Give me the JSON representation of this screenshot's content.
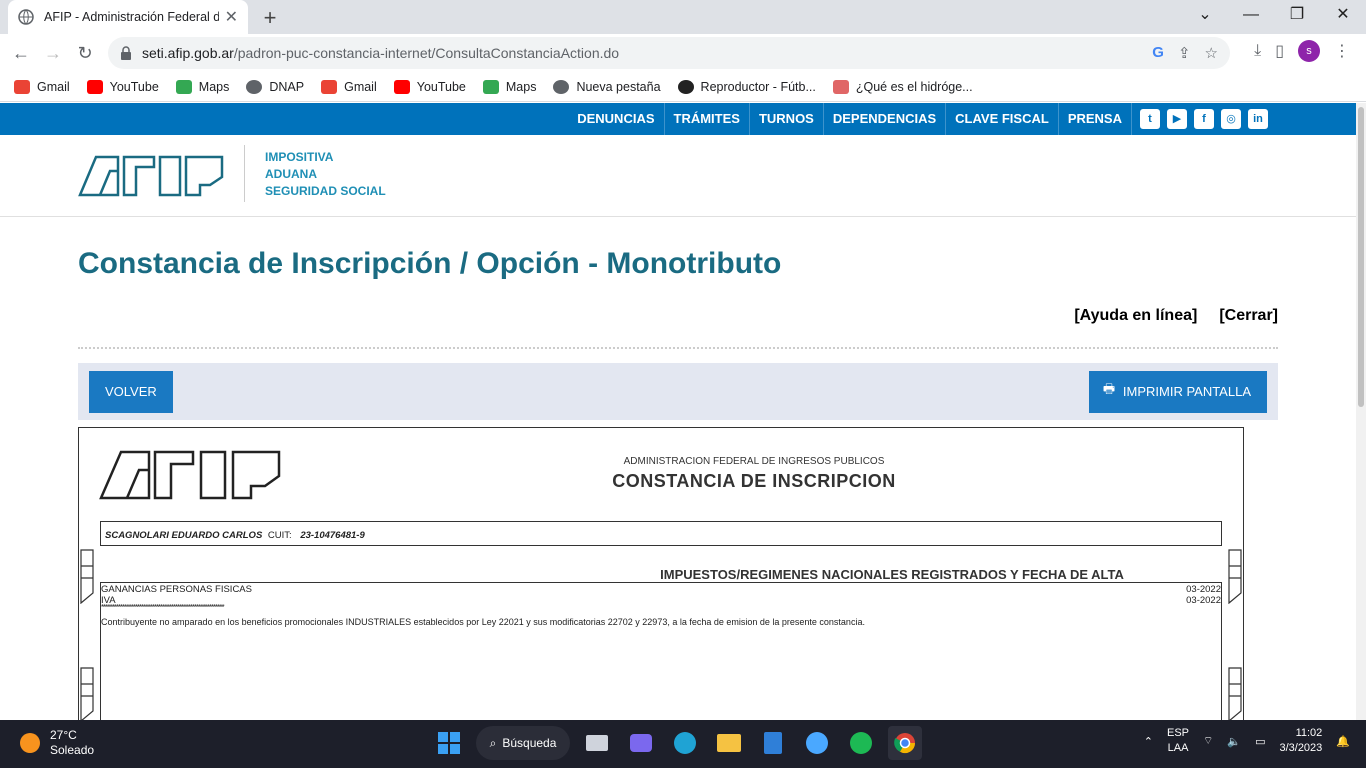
{
  "browser": {
    "tab_title": "AFIP - Administración Federal de",
    "url_host": "seti.afip.gob.ar",
    "url_path": "/padron-puc-constancia-internet/ConsultaConstanciaAction.do",
    "avatar_letter": "s"
  },
  "bookmarks": [
    {
      "label": "Gmail",
      "icon": "gmail-icon"
    },
    {
      "label": "YouTube",
      "icon": "youtube-icon"
    },
    {
      "label": "Maps",
      "icon": "maps-icon"
    },
    {
      "label": "DNAP",
      "icon": "globe-icon"
    },
    {
      "label": "Gmail",
      "icon": "gmail-icon"
    },
    {
      "label": "YouTube",
      "icon": "youtube-icon"
    },
    {
      "label": "Maps",
      "icon": "maps-icon"
    },
    {
      "label": "Nueva pestaña",
      "icon": "globe-icon"
    },
    {
      "label": "Reproductor - Fútb...",
      "icon": "soccer-ball-icon"
    },
    {
      "label": "¿Qué es el hidróge...",
      "icon": "leaf-icon"
    }
  ],
  "site_nav": {
    "items": [
      "DENUNCIAS",
      "TRÁMITES",
      "TURNOS",
      "DEPENDENCIAS",
      "CLAVE FISCAL",
      "PRENSA"
    ],
    "social": [
      {
        "name": "twitter-icon",
        "glyph": "t"
      },
      {
        "name": "youtube-icon",
        "glyph": "▶"
      },
      {
        "name": "facebook-icon",
        "glyph": "f"
      },
      {
        "name": "instagram-icon",
        "glyph": "◎"
      },
      {
        "name": "linkedin-icon",
        "glyph": "in"
      }
    ]
  },
  "header": {
    "tagline": [
      "IMPOSITIVA",
      "ADUANA",
      "SEGURIDAD SOCIAL"
    ]
  },
  "main": {
    "title": "Constancia de Inscripción / Opción - Monotributo",
    "help_link": "[Ayuda en línea]",
    "close_link": "[Cerrar]",
    "back_button": "VOLVER",
    "print_button": "IMPRIMIR PANTALLA"
  },
  "document": {
    "org": "ADMINISTRACION FEDERAL DE INGRESOS PUBLICOS",
    "title": "CONSTANCIA DE INSCRIPCION",
    "name": "SCAGNOLARI EDUARDO CARLOS",
    "cuit_label": "CUIT:",
    "cuit": "23-10476481-9",
    "section_title": "IMPUESTOS/REGIMENES NACIONALES REGISTRADOS Y FECHA DE ALTA",
    "taxes": [
      {
        "name": "GANANCIAS PERSONAS FISICAS",
        "date": "03-2022"
      },
      {
        "name": "IVA",
        "date": "03-2022"
      }
    ],
    "separator": "**********************************************************",
    "note": "Contribuyente no amparado en los beneficios promocionales INDUSTRIALES establecidos por Ley 22021 y sus modificatorias 22702 y 22973, a la fecha de emision de la presente constancia."
  },
  "taskbar": {
    "temp": "27°C",
    "weather": "Soleado",
    "search_label": "Búsqueda",
    "lang1": "ESP",
    "lang2": "LAA",
    "time": "11:02",
    "date": "3/3/2023"
  },
  "colors": {
    "nav_blue": "#0072bb",
    "title_teal": "#1a6b82",
    "button_blue": "#1a79c2"
  }
}
